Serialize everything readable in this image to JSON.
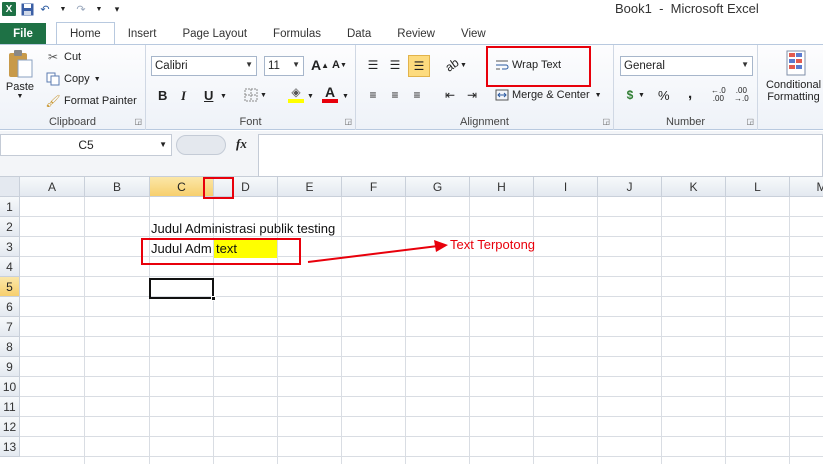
{
  "window": {
    "title": "Book1  -  Microsoft Excel"
  },
  "quick_access": {
    "logo": "X"
  },
  "tabs": [
    "File",
    "Home",
    "Insert",
    "Page Layout",
    "Formulas",
    "Data",
    "Review",
    "View"
  ],
  "clipboard": {
    "paste": "Paste",
    "cut": "Cut",
    "copy": "Copy",
    "format_painter": "Format Painter",
    "label": "Clipboard"
  },
  "font": {
    "family": "Calibri",
    "size": "11",
    "label": "Font",
    "bold": "B",
    "italic": "I",
    "underline": "U"
  },
  "alignment": {
    "wrap_text": "Wrap Text",
    "merge_center": "Merge & Center",
    "label": "Alignment"
  },
  "number": {
    "format": "General",
    "currency": "$",
    "percent": "%",
    "comma": ",",
    "label": "Number"
  },
  "styles": {
    "conditional_line1": "Conditional",
    "conditional_line2": "Formatting"
  },
  "formula_bar": {
    "name_box": "C5",
    "fx": "fx"
  },
  "grid": {
    "columns": [
      "A",
      "B",
      "C",
      "D",
      "E",
      "F",
      "G",
      "H",
      "I",
      "J",
      "K",
      "L",
      "M"
    ],
    "rows": [
      "1",
      "2",
      "3",
      "4",
      "5",
      "6",
      "7",
      "8",
      "9",
      "10",
      "11",
      "12",
      "13"
    ],
    "selected_column": "C",
    "selected_row": "5",
    "cells": {
      "C2": "Judul Administrasi publik  testing",
      "C3_visible": "Judul Adm",
      "D3": "text"
    }
  },
  "annotation": {
    "label": "Text Terpotong",
    "color": "#e8000b"
  },
  "colors": {
    "excel_green": "#1e7145",
    "selection_header": "#f7cf6d",
    "highlight": "#ffff00"
  }
}
